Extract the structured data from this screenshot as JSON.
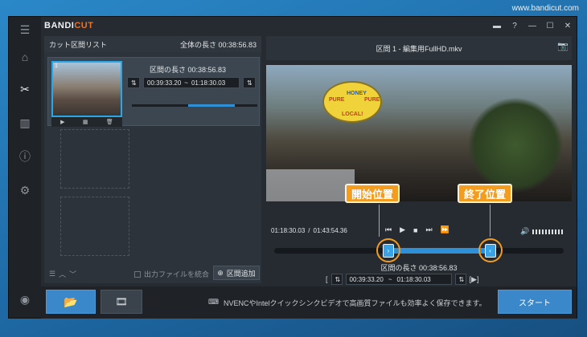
{
  "desktop": {
    "site": "www.bandicut.com"
  },
  "app": {
    "logo_a": "BANDI",
    "logo_b": "CUT"
  },
  "left": {
    "header": "カット区間リスト",
    "total": "全体の長さ 00:38:56.83",
    "clip": {
      "index": "1",
      "length_label": "区間の長さ 00:38:56.83",
      "start": "00:39:33.20",
      "sep": "~",
      "end": "01:18:30.03"
    },
    "merge_label": "出力ファイルを統合",
    "add_label": "区間追加"
  },
  "right": {
    "title": "区間 1 - 編集用FullHD.mkv",
    "time_current": "01:18:30.03",
    "time_sep": "/",
    "time_total": "01:43:54.36",
    "length_label": "区間の長さ 00:38:56.83",
    "start": "00:39:33.20",
    "sep": "~",
    "end": "01:18:30.03",
    "start_callout": "開始位置",
    "end_callout": "終了位置",
    "bracket_left": "[",
    "bracket_right": "[▶]",
    "sign": {
      "pure1": "PURE",
      "pure2": "PURE",
      "honey": "HONEY",
      "local": "LOCAL!"
    }
  },
  "bottom": {
    "info": "NVENCやIntelクイックシンクビデオで高画質ファイルも効率よく保存できます。",
    "start_label": "スタート"
  },
  "progress": {
    "clip_segment_fraction": 0.37,
    "clip_segment_start": 0.45,
    "track_start": 0.38,
    "track_end": 0.76
  }
}
